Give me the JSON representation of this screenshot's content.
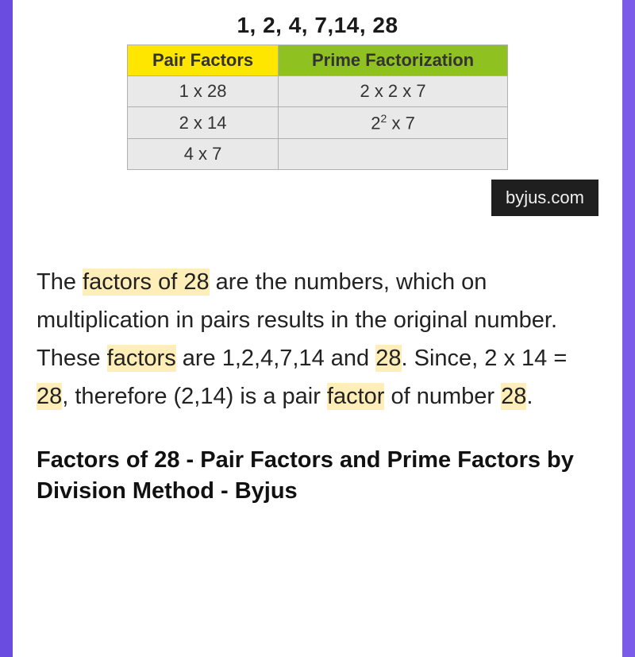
{
  "factors_heading": "1, 2, 4, 7,14, 28",
  "table": {
    "header_pair": "Pair Factors",
    "header_prime": "Prime Factorization",
    "rows": [
      {
        "pair": "1 x 28",
        "prime": "2 x 2 x 7"
      },
      {
        "pair": "2 x 14",
        "prime_base": "2",
        "prime_exp": "2",
        "prime_tail": " x 7"
      },
      {
        "pair": "4 x 7",
        "prime": ""
      }
    ]
  },
  "source_badge": "byjus.com",
  "description": {
    "t1": "The ",
    "h1": "factors of 28",
    "t2": " are the numbers, which on multiplication in pairs results in the original number. These ",
    "h2": "factors",
    "t3": " are 1,2,4,7,14 and ",
    "h3": "28",
    "t4": ". Since, 2 x 14 = ",
    "h4": "28",
    "t5": ", therefore (2,14) is a pair ",
    "h5": "factor",
    "t6": " of number ",
    "h6": "28",
    "t7": "."
  },
  "article_title": "Factors of 28 - Pair Factors and Prime Factors by Division Method - Byjus"
}
